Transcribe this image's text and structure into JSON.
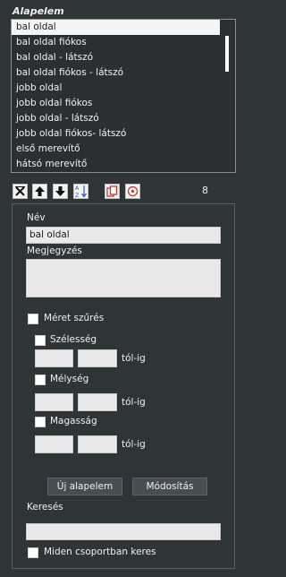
{
  "header": {
    "title": "Alapelem"
  },
  "list": {
    "items": [
      "bal oldal",
      "bal oldal fiókos",
      "bal oldal - látszó",
      "bal oldal fiókos - látszó",
      "jobb oldal",
      "jobb oldal fiókos",
      "jobb oldal - látszó",
      "jobb oldal fiókos- látszó",
      "első merevítő",
      "hátsó merevítő"
    ],
    "selected_index": 0
  },
  "toolbar": {
    "icons": [
      "delete-x-icon",
      "arrow-up-icon",
      "arrow-down-icon",
      "sort-az-icon",
      "copy-icon",
      "target-icon"
    ],
    "count": "8"
  },
  "form": {
    "name_label": "Név",
    "name_value": "bal oldal",
    "note_label": "Megjegyzés",
    "note_value": "",
    "size_filter_label": "Méret szűrés",
    "width_label": "Szélesség",
    "depth_label": "Mélység",
    "height_label": "Magasság",
    "range_label": "tól-ig",
    "new_button": "Új alapelem",
    "modify_button": "Módosítás",
    "search_label": "Keresés",
    "search_value": "",
    "all_groups_label": "Miden csoportban keres"
  }
}
